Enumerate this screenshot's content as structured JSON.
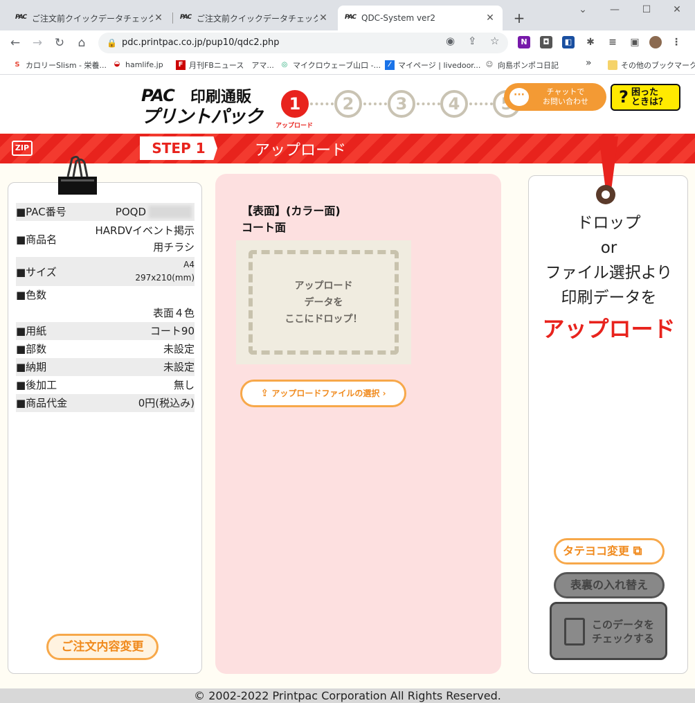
{
  "browser": {
    "tabs": [
      {
        "title": "ご注文前クイックデータチェック　サービス",
        "active": false
      },
      {
        "title": "ご注文前クイックデータチェック　サービス",
        "active": false
      },
      {
        "title": "QDC-System ver2",
        "active": true
      }
    ],
    "favicon_text": "PAC",
    "url": "pdc.printpac.co.jp/pup10/qdc2.php",
    "bookmarks": [
      "カロリーSlism - 栄養...",
      "hamlife.jp",
      "月刊FBニュース　アマ...",
      "マイクロウェーブ山口 -...",
      "マイページ | livedoor...",
      "向島ポンポコ日記"
    ],
    "other_bookmarks": "その他のブックマーク",
    "more_bookmarks": "»"
  },
  "header": {
    "logo_pac": "PAC",
    "logo_sub": "印刷通販",
    "logo_main": "プリントパック",
    "steps": [
      "1",
      "2",
      "3",
      "4",
      "5"
    ],
    "current_step_label": "アップロード",
    "chat_line1": "チャットで",
    "chat_line2": "お問い合わせ",
    "help_line1": "困った",
    "help_line2": "ときは？",
    "help_q": "?"
  },
  "stepbar": {
    "zip": "ZIP",
    "step": "STEP 1",
    "title": "アップロード"
  },
  "order": {
    "rows": [
      {
        "key": "■PAC番号",
        "value": "POQD"
      },
      {
        "key": "■商品名",
        "value": "HARDVイベント掲示",
        "value2": "用チラシ"
      },
      {
        "key": "■サイズ",
        "value": "A4",
        "value2": "297x210(mm)"
      },
      {
        "key": "■色数",
        "value": "表面４色"
      },
      {
        "key": "■用紙",
        "value": "コート90"
      },
      {
        "key": "■部数",
        "value": "未設定"
      },
      {
        "key": "■納期",
        "value": "未設定"
      },
      {
        "key": "■後加工",
        "value": "無し"
      },
      {
        "key": "■商品代金",
        "value": "0円(税込み)"
      }
    ],
    "change_button": "ご注文内容変更"
  },
  "upload": {
    "face_title": "【表面】(カラー面)",
    "face_paper": "コート面",
    "drop_line1": "アップロード",
    "drop_line2": "データを",
    "drop_line3": "ここにドロップ！",
    "select_button": "アップロードファイルの選択"
  },
  "right": {
    "line1": "ドロップ",
    "line2": "or",
    "line3": "ファイル選択より",
    "line4": "印刷データを",
    "emphasis": "アップロード",
    "rotate_button": "タテヨコ変更",
    "swap_button": "表裏の入れ替え",
    "check_line1": "このデータを",
    "check_line2": "チェックする"
  },
  "footer": {
    "copyright": "© 2002-2022 Printpac Corporation All Rights Reserved."
  },
  "colors": {
    "brand_red": "#e8231d",
    "accent_orange": "#f39a34",
    "help_yellow": "#ffea00",
    "drop_pink": "#fde0e0"
  }
}
